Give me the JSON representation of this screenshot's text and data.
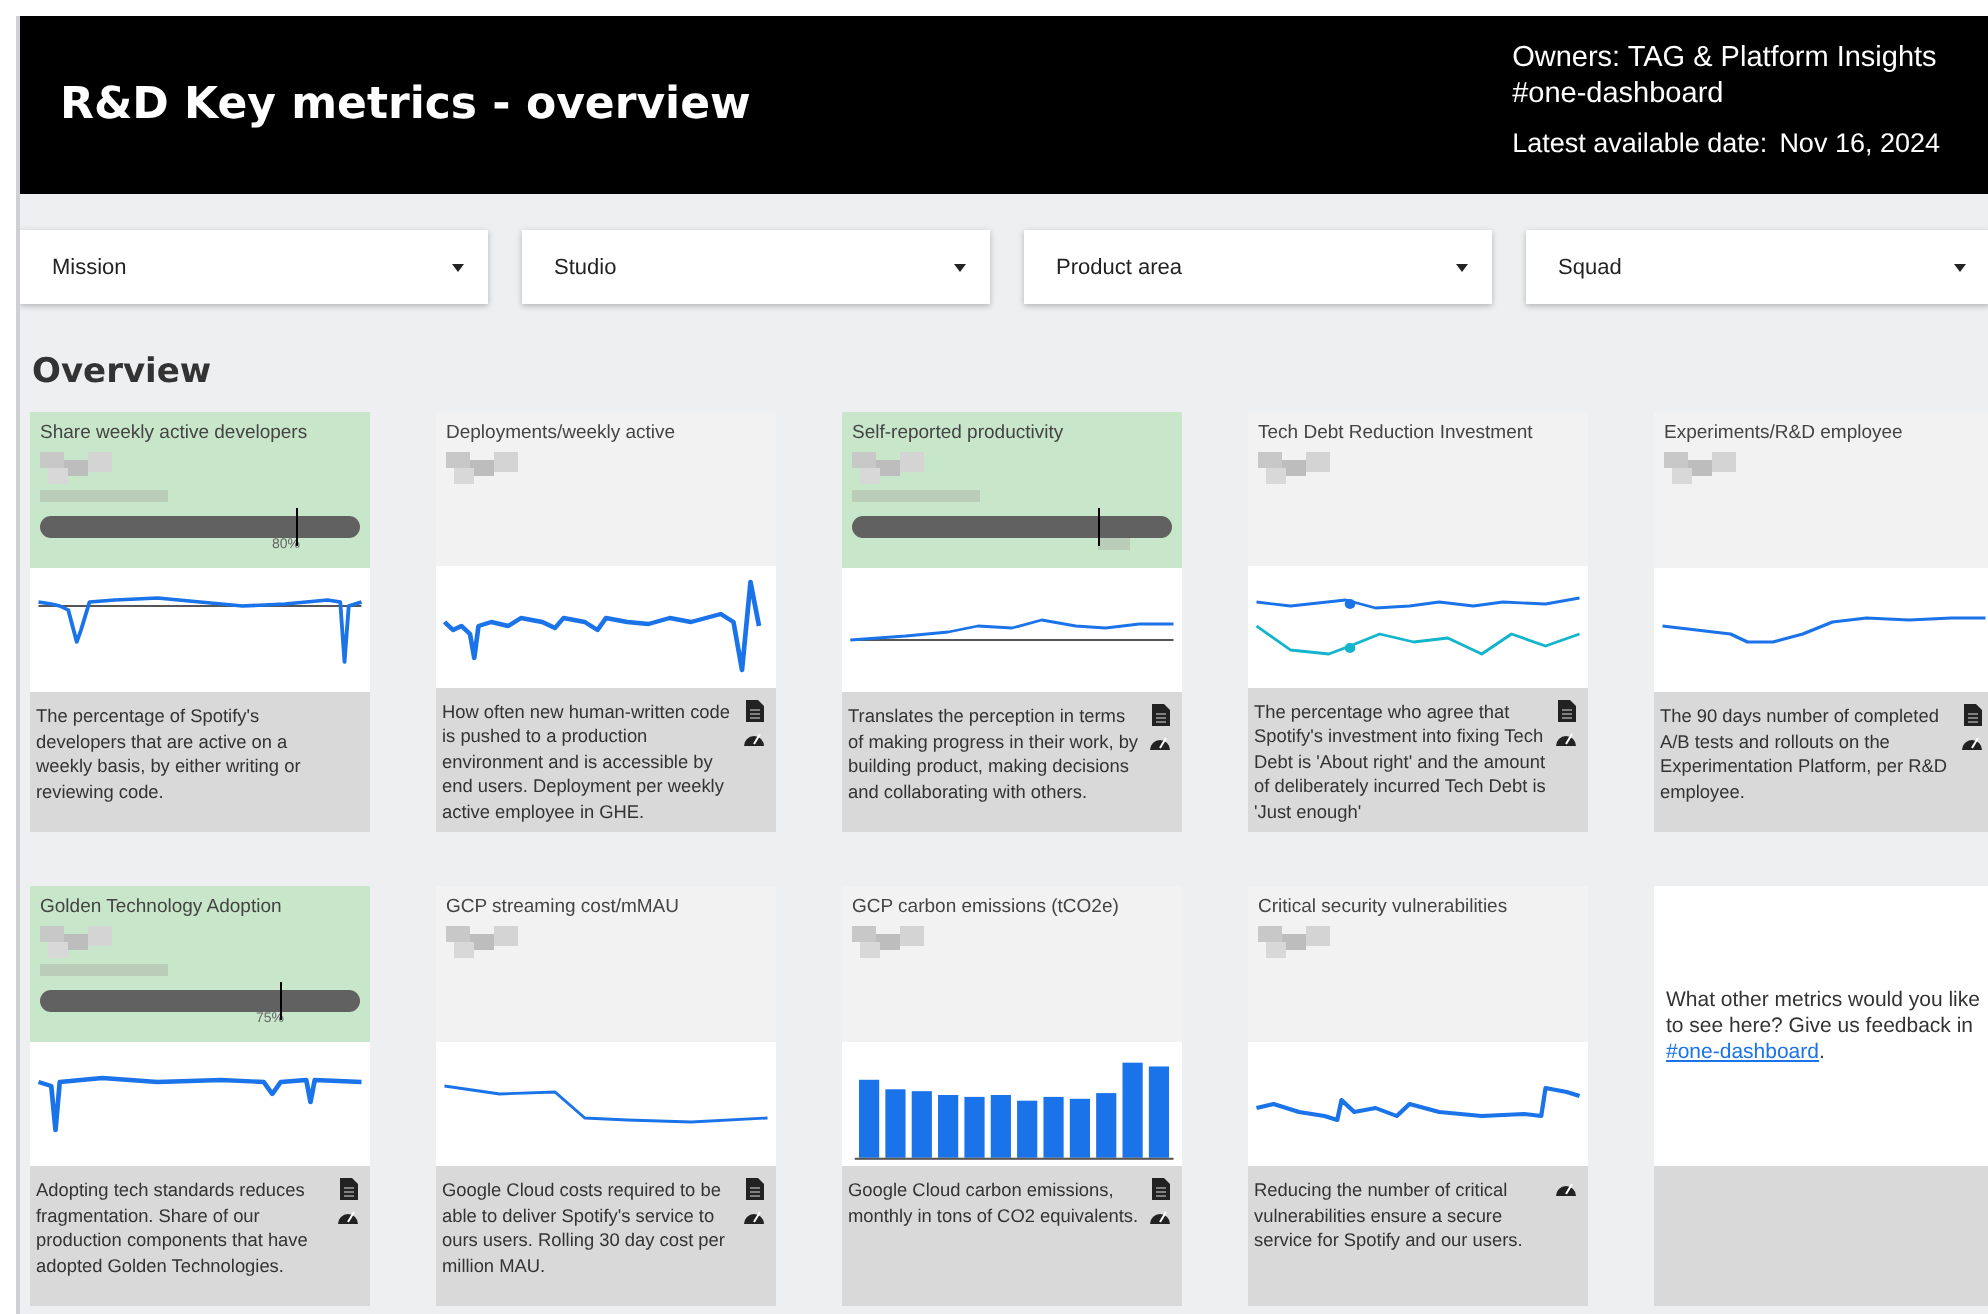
{
  "header": {
    "title": "R&D Key metrics - overview",
    "owners": "Owners: TAG & Platform Insights",
    "channel": "#one-dashboard",
    "date_label": "Latest available date:",
    "date": "Nov 16, 2024"
  },
  "filters": [
    {
      "label": "Mission"
    },
    {
      "label": "Studio"
    },
    {
      "label": "Product area"
    },
    {
      "label": "Squad"
    }
  ],
  "section_title": "Overview",
  "cards": [
    {
      "title": "Share weekly active developers",
      "highlighted": true,
      "gauge": {
        "level": 0.8,
        "label": "80%"
      },
      "chart": {
        "kind": "spiky-target"
      },
      "description": "The percentage of Spotify's developers that are active on a weekly basis, by either writing or reviewing code.",
      "doc_icon": false,
      "gauge_icon": false
    },
    {
      "title": "Deployments/weekly active",
      "highlighted": false,
      "chart": {
        "kind": "noisy"
      },
      "description": "How often new human-written code is pushed to a production environment and is accessible by end users. Deployment per weekly active employee in GHE.",
      "doc_icon": true,
      "gauge_icon": true
    },
    {
      "title": "Self-reported productivity",
      "highlighted": true,
      "gauge": {
        "level": 0.77
      },
      "chart": {
        "kind": "trend-target"
      },
      "description": "Translates the perception in terms of making progress in their work, by building product, making decisions and collaborating with others.",
      "doc_icon": true,
      "gauge_icon": true
    },
    {
      "title": "Tech Debt Reduction Investment",
      "highlighted": false,
      "chart": {
        "kind": "dual"
      },
      "description": "The percentage who agree that Spotify's investment into fixing Tech Debt is 'About right' and the amount of deliberately incurred Tech Debt is 'Just enough'",
      "doc_icon": true,
      "gauge_icon": true
    },
    {
      "title": "Experiments/R&D employee",
      "highlighted": false,
      "chart": {
        "kind": "smooth"
      },
      "description": "The 90 days number of completed A/B tests and rollouts on the Experimentation Platform, per R&D employee.",
      "doc_icon": true,
      "gauge_icon": true
    },
    {
      "title": "Golden Technology Adoption",
      "highlighted": true,
      "gauge": {
        "level": 0.75,
        "label": "75%"
      },
      "chart": {
        "kind": "flat-spikes"
      },
      "description": "Adopting tech standards reduces fragmentation. Share of our production components that have adopted Golden Technologies.",
      "doc_icon": true,
      "gauge_icon": true
    },
    {
      "title": "GCP streaming cost/mMAU",
      "highlighted": false,
      "chart": {
        "kind": "drop"
      },
      "description": "Google Cloud costs required to be able to deliver Spotify's service to ours users. Rolling 30 day cost per million MAU.",
      "doc_icon": true,
      "gauge_icon": true
    },
    {
      "title": "GCP carbon emissions (tCO2e)",
      "highlighted": false,
      "chart": {
        "kind": "bars"
      },
      "description": "Google Cloud carbon emissions, monthly in tons of CO2 equivalents.",
      "doc_icon": true,
      "gauge_icon": true
    },
    {
      "title": "Critical security vulnerabilities",
      "highlighted": false,
      "chart": {
        "kind": "step"
      },
      "description": "Reducing the number of critical vulnerabilities ensure a secure service for Spotify and our users.",
      "doc_icon": false,
      "gauge_icon": true
    }
  ],
  "feedback": {
    "text": "What other metrics would you like to see here? Give us feedback in",
    "link": "#one-dashboard",
    "end": "."
  }
}
